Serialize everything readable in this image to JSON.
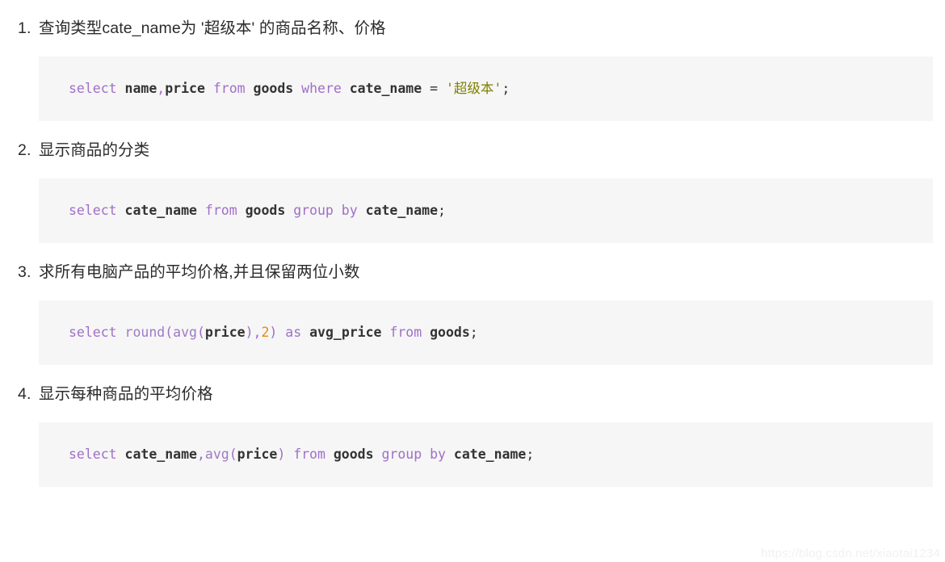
{
  "page": {
    "background_color": "#ffffff",
    "code_background_color": "#f6f6f6",
    "text_color": "#2b2b2b"
  },
  "syntax_colors": {
    "keyword": "#a06fc8",
    "function": "#9f7bc4",
    "identifier": "#333333",
    "string": "#808000",
    "number": "#e8890c"
  },
  "items": [
    {
      "number": "1.",
      "title": "查询类型cate_name为 '超级本' 的商品名称、价格",
      "code_tokens": [
        {
          "t": "select",
          "k": "kw"
        },
        {
          "t": " ",
          "k": "punc"
        },
        {
          "t": "name",
          "k": "id"
        },
        {
          "t": ",",
          "k": "pk"
        },
        {
          "t": "price",
          "k": "id"
        },
        {
          "t": " ",
          "k": "punc"
        },
        {
          "t": "from",
          "k": "kw"
        },
        {
          "t": " ",
          "k": "punc"
        },
        {
          "t": "goods",
          "k": "id"
        },
        {
          "t": " ",
          "k": "punc"
        },
        {
          "t": "where",
          "k": "kw"
        },
        {
          "t": " ",
          "k": "punc"
        },
        {
          "t": "cate_name",
          "k": "id"
        },
        {
          "t": " ",
          "k": "punc"
        },
        {
          "t": "=",
          "k": "op"
        },
        {
          "t": " ",
          "k": "punc"
        },
        {
          "t": "'超级本'",
          "k": "str"
        },
        {
          "t": ";",
          "k": "punc"
        }
      ],
      "code_plain": "select name,price from goods where cate_name = '超级本';"
    },
    {
      "number": "2.",
      "title": "显示商品的分类",
      "code_tokens": [
        {
          "t": "select",
          "k": "kw"
        },
        {
          "t": " ",
          "k": "punc"
        },
        {
          "t": "cate_name",
          "k": "id"
        },
        {
          "t": " ",
          "k": "punc"
        },
        {
          "t": "from",
          "k": "kw"
        },
        {
          "t": " ",
          "k": "punc"
        },
        {
          "t": "goods",
          "k": "id"
        },
        {
          "t": " ",
          "k": "punc"
        },
        {
          "t": "group",
          "k": "kw"
        },
        {
          "t": " ",
          "k": "punc"
        },
        {
          "t": "by",
          "k": "kw"
        },
        {
          "t": " ",
          "k": "punc"
        },
        {
          "t": "cate_name",
          "k": "id"
        },
        {
          "t": ";",
          "k": "punc"
        }
      ],
      "code_plain": "select cate_name from goods group by cate_name;"
    },
    {
      "number": "3.",
      "title": "求所有电脑产品的平均价格,并且保留两位小数",
      "code_tokens": [
        {
          "t": "select",
          "k": "kw"
        },
        {
          "t": " ",
          "k": "punc"
        },
        {
          "t": "round",
          "k": "fn"
        },
        {
          "t": "(",
          "k": "pk"
        },
        {
          "t": "avg",
          "k": "fn"
        },
        {
          "t": "(",
          "k": "pk"
        },
        {
          "t": "price",
          "k": "id"
        },
        {
          "t": ")",
          "k": "pk"
        },
        {
          "t": ",",
          "k": "pk"
        },
        {
          "t": "2",
          "k": "num"
        },
        {
          "t": ")",
          "k": "pk"
        },
        {
          "t": " ",
          "k": "punc"
        },
        {
          "t": "as",
          "k": "kw"
        },
        {
          "t": " ",
          "k": "punc"
        },
        {
          "t": "avg_price",
          "k": "id"
        },
        {
          "t": " ",
          "k": "punc"
        },
        {
          "t": "from",
          "k": "kw"
        },
        {
          "t": " ",
          "k": "punc"
        },
        {
          "t": "goods",
          "k": "id"
        },
        {
          "t": ";",
          "k": "punc"
        }
      ],
      "code_plain": "select round(avg(price),2) as avg_price from goods;"
    },
    {
      "number": "4.",
      "title": "显示每种商品的平均价格",
      "code_tokens": [
        {
          "t": "select",
          "k": "kw"
        },
        {
          "t": " ",
          "k": "punc"
        },
        {
          "t": "cate_name",
          "k": "id"
        },
        {
          "t": ",",
          "k": "pk"
        },
        {
          "t": "avg",
          "k": "fn"
        },
        {
          "t": "(",
          "k": "pk"
        },
        {
          "t": "price",
          "k": "id"
        },
        {
          "t": ")",
          "k": "pk"
        },
        {
          "t": " ",
          "k": "punc"
        },
        {
          "t": "from",
          "k": "kw"
        },
        {
          "t": " ",
          "k": "punc"
        },
        {
          "t": "goods",
          "k": "id"
        },
        {
          "t": " ",
          "k": "punc"
        },
        {
          "t": "group",
          "k": "kw"
        },
        {
          "t": " ",
          "k": "punc"
        },
        {
          "t": "by",
          "k": "kw"
        },
        {
          "t": " ",
          "k": "punc"
        },
        {
          "t": "cate_name",
          "k": "id"
        },
        {
          "t": ";",
          "k": "punc"
        }
      ],
      "code_plain": "select cate_name,avg(price) from goods group by cate_name;"
    }
  ],
  "watermark": {
    "text": "https://blog.csdn.net/xiaotai1234"
  }
}
